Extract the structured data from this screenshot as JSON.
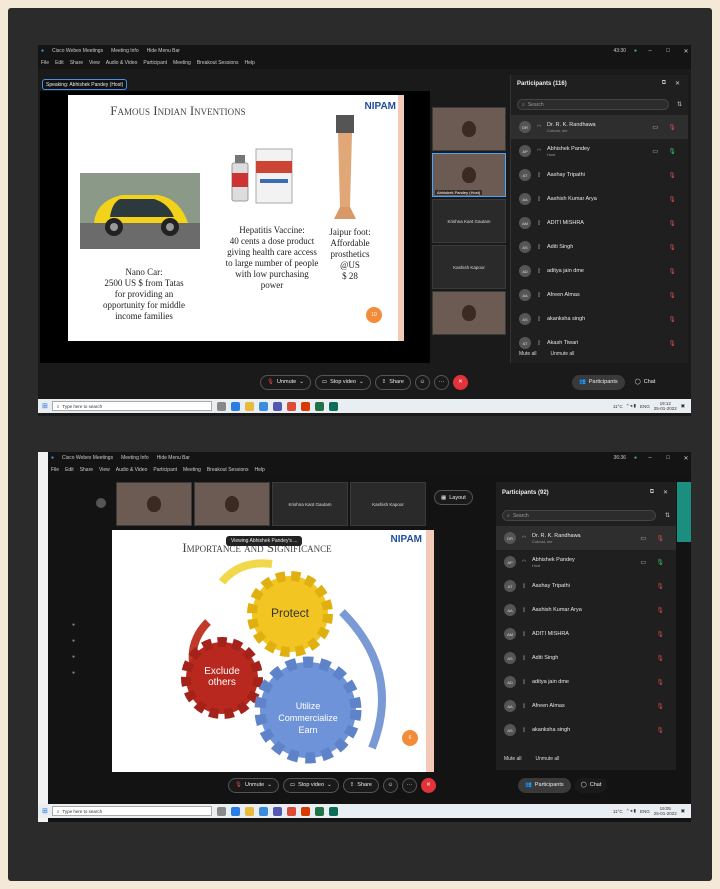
{
  "s1": {
    "app_title": "Cisco Webex Meetings",
    "meeting_info": "Meeting Info",
    "hide_menu": "Hide Menu Bar",
    "time": "43:30",
    "menu": [
      "File",
      "Edit",
      "Share",
      "View",
      "Audio & Video",
      "Participant",
      "Meeting",
      "Breakout Sessions",
      "Help"
    ],
    "speaking": "Speaking: Abhishek Pandey (Host)",
    "slide_title": "Famous Indian Inventions",
    "logo": "NIPAM",
    "car_text": "Nano Car:\n2500 US $  from Tatas\nfor providing an\nopportunity for middle\nincome families",
    "vaccine_text": "Hepatitis Vaccine:\n40 cents a dose product\ngiving health care access\nto large number of people\nwith low purchasing\npower",
    "foot_text": "Jaipur foot:\nAffordable\nprosthetics\n@US\n$ 28",
    "slide_number": "10",
    "thumb_host": "Abhishek Pandey (Host)",
    "thumb_krishna": "Krishna Kant Gautam",
    "thumb_kashish": "Kashish Kapoor",
    "panel_title": "Participants (116)",
    "search": "Search",
    "participants": [
      {
        "init": "DR",
        "name": "Dr. R. K. Randhawa",
        "sub": "Cohost, me",
        "mic": "muted",
        "cam": true
      },
      {
        "init": "AP",
        "name": "Abhishek Pandey",
        "sub": "Host",
        "mic": "on",
        "cam": true
      },
      {
        "init": "AT",
        "name": "Aashay Tripathi",
        "sub": "",
        "mic": "muted",
        "cam": false
      },
      {
        "init": "AA",
        "name": "Aashish Kumar Arya",
        "sub": "",
        "mic": "muted",
        "cam": false
      },
      {
        "init": "AM",
        "name": "ADITI MISHRA",
        "sub": "",
        "mic": "muted",
        "cam": false
      },
      {
        "init": "AS",
        "name": "Aditi Singh",
        "sub": "",
        "mic": "muted",
        "cam": false
      },
      {
        "init": "AD",
        "name": "aditya jain dme",
        "sub": "",
        "mic": "muted",
        "cam": false
      },
      {
        "init": "AA",
        "name": "Afreen Almas",
        "sub": "",
        "mic": "muted",
        "cam": false
      },
      {
        "init": "AS",
        "name": "akanksha singh",
        "sub": "",
        "mic": "muted",
        "cam": false
      },
      {
        "init": "AT",
        "name": "Akash Tiwari",
        "sub": "",
        "mic": "muted",
        "cam": false
      }
    ],
    "mute_all": "Mute all",
    "unmute_all": "Unmute all",
    "unmute": "Unmute",
    "stop_video": "Stop video",
    "share": "Share",
    "participants_btn": "Participants",
    "chat": "Chat",
    "taskbar_search": "Type here to search",
    "weather": "11°C",
    "lang": "ENG",
    "clock_time": "19:12",
    "clock_date": "25-01-2022"
  },
  "s2": {
    "app_title": "Cisco Webex Meetings",
    "meeting_info": "Meeting Info",
    "hide_menu": "Hide Menu Bar",
    "time": "36:36",
    "menu": [
      "File",
      "Edit",
      "Share",
      "View",
      "Audio & Video",
      "Participant",
      "Meeting",
      "Breakout Sessions",
      "Help"
    ],
    "thumb_krishna": "Krishna Kant Gautam",
    "thumb_kashish": "Kashish Kapoor",
    "layout": "Layout",
    "viewing": "Viewing Abhishek Pandey's ...",
    "slide_title": "Importance and Significance",
    "logo": "NIPAM",
    "gear_protect": "Protect",
    "gear_exclude": "Exclude\nothers",
    "gear_utilize": "Utilize\nCommercialize\nEarn",
    "slide_number": "6",
    "panel_title": "Participants (92)",
    "search": "Search",
    "participants": [
      {
        "init": "DR",
        "name": "Dr. R. K. Randhawa",
        "sub": "Cohost, me",
        "mic": "muted",
        "cam": true
      },
      {
        "init": "AP",
        "name": "Abhishek Pandey",
        "sub": "Host",
        "mic": "on",
        "cam": true
      },
      {
        "init": "AT",
        "name": "Aashay Tripathi",
        "sub": "",
        "mic": "muted",
        "cam": false
      },
      {
        "init": "AA",
        "name": "Aashish Kumar Arya",
        "sub": "",
        "mic": "muted",
        "cam": false
      },
      {
        "init": "AM",
        "name": "ADITI MISHRA",
        "sub": "",
        "mic": "muted",
        "cam": false
      },
      {
        "init": "AS",
        "name": "Aditi Singh",
        "sub": "",
        "mic": "muted",
        "cam": false
      },
      {
        "init": "AD",
        "name": "aditya jain dme",
        "sub": "",
        "mic": "muted",
        "cam": false
      },
      {
        "init": "AA",
        "name": "Afreen Almas",
        "sub": "",
        "mic": "muted",
        "cam": false
      },
      {
        "init": "AS",
        "name": "akanksha singh",
        "sub": "",
        "mic": "muted",
        "cam": false
      }
    ],
    "mute_all": "Mute all",
    "unmute_all": "Unmute all",
    "unmute": "Unmute",
    "stop_video": "Stop video",
    "share": "Share",
    "participants_btn": "Participants",
    "chat": "Chat",
    "taskbar_search": "Type here to search",
    "weather": "11°C",
    "lang": "ENG",
    "clock_time": "19:05",
    "clock_date": "25-01-2022"
  }
}
